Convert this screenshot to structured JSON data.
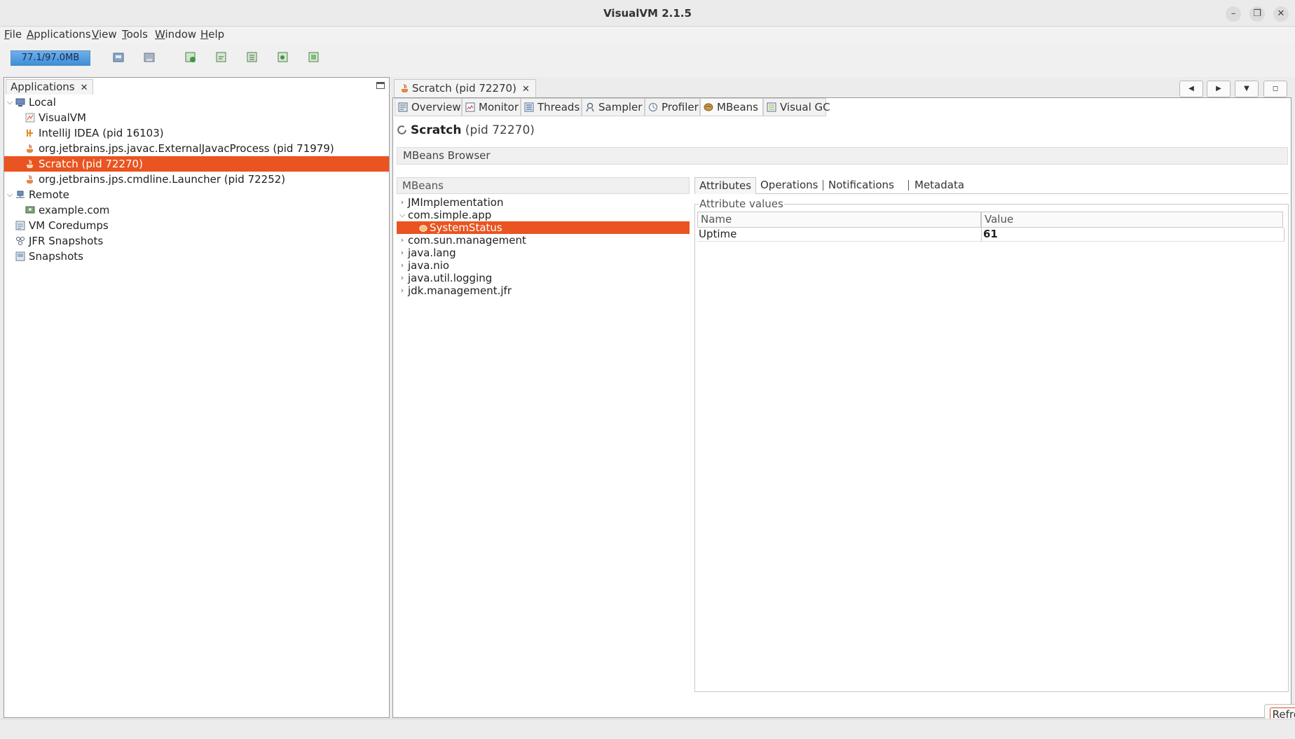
{
  "window": {
    "title": "VisualVM 2.1.5"
  },
  "menu": [
    "File",
    "Applications",
    "View",
    "Tools",
    "Window",
    "Help"
  ],
  "toolbar": {
    "memory_label": "77.1/97.0MB",
    "memory_fraction": 0.79
  },
  "applications_panel": {
    "tab_label": "Applications",
    "tree": {
      "local": {
        "label": "Local",
        "items": [
          "VisualVM",
          "IntelliJ IDEA (pid 16103)",
          "org.jetbrains.jps.javac.ExternalJavacProcess (pid 71979)",
          "Scratch (pid 72270)",
          "org.jetbrains.jps.cmdline.Launcher (pid 72252)"
        ]
      },
      "remote": {
        "label": "Remote",
        "items": [
          "example.com"
        ]
      },
      "others": [
        "VM Coredumps",
        "JFR Snapshots",
        "Snapshots"
      ]
    },
    "selected": "Scratch (pid 72270)"
  },
  "document": {
    "tab_label": "Scratch (pid 72270)",
    "subtabs": [
      "Overview",
      "Monitor",
      "Threads",
      "Sampler",
      "Profiler",
      "MBeans",
      "Visual GC"
    ],
    "active_subtab": "MBeans",
    "app_name": "Scratch",
    "app_pid": "(pid 72270)",
    "section_title": "MBeans Browser",
    "mbeans_header": "MBeans",
    "mbeans_tree": [
      "JMImplementation",
      "com.simple.app",
      "SystemStatus",
      "com.sun.management",
      "java.lang",
      "java.nio",
      "java.util.logging",
      "jdk.management.jfr"
    ],
    "attr_tabs": [
      "Attributes",
      "Operations",
      "Notifications",
      "Metadata"
    ],
    "attr_values_label": "Attribute values",
    "table": {
      "columns": [
        "Name",
        "Value"
      ],
      "rows": [
        {
          "name": "Uptime",
          "value": "61"
        }
      ]
    },
    "refresh_label": "Refresh"
  },
  "colors": {
    "selection": "#e95420",
    "memory_bar": "#3e8ed8"
  }
}
